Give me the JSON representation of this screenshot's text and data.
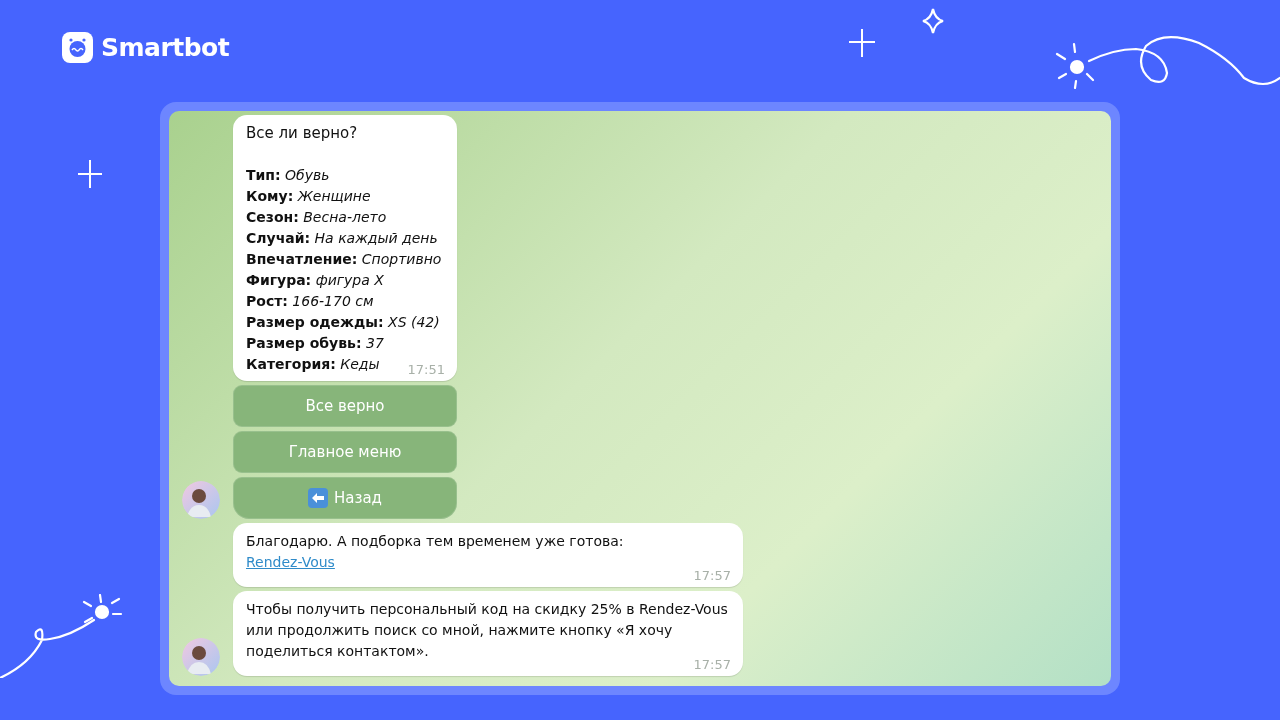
{
  "brand": {
    "name": "Smartbot"
  },
  "chat": {
    "messages": [
      {
        "kind": "summary",
        "avatar": false,
        "title": "Все ли верно?",
        "fields": [
          {
            "label": "Тип:",
            "value": "Обувь"
          },
          {
            "label": "Кому:",
            "value": "Женщине"
          },
          {
            "label": "Сезон:",
            "value": "Весна-лето"
          },
          {
            "label": "Случай:",
            "value": "На каждый день"
          },
          {
            "label": "Впечатление:",
            "value": "Спортивно"
          },
          {
            "label": "Фигура:",
            "value": "фигура X"
          },
          {
            "label": "Рост:",
            "value": "166-170 см"
          },
          {
            "label": "Размер одежды:",
            "value": "XS (42)"
          },
          {
            "label": "Размер обувь:",
            "value": "37"
          },
          {
            "label": "Категория:",
            "value": "Кеды"
          }
        ],
        "time": "17:51"
      },
      {
        "kind": "keyboard",
        "avatar": true,
        "buttons": [
          {
            "label": "Все верно"
          },
          {
            "label": "Главное меню"
          },
          {
            "label": "Назад"
          }
        ]
      },
      {
        "kind": "text",
        "avatar": false,
        "text": "Благодарю. А подборка тем временем уже готова:",
        "link": "Rendez-Vous",
        "time": "17:57"
      },
      {
        "kind": "text",
        "avatar": true,
        "text": "Чтобы получить персональный код на скидку 25% в Rendez-Vous или продолжить поиск со мной, нажмите кнопку «Я хочу поделиться контактом».",
        "time": "17:57"
      }
    ]
  }
}
